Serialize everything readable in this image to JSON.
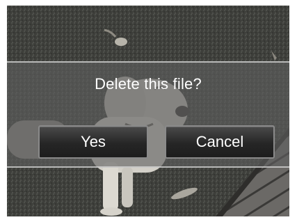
{
  "dialog": {
    "message": "Delete this file?",
    "yes_label": "Yes",
    "cancel_label": "Cancel"
  }
}
